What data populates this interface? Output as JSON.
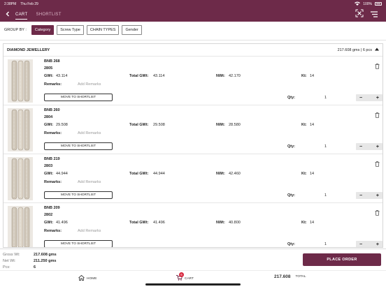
{
  "status_bar": {
    "time": "2:38PM",
    "date": "Thu Feb 29",
    "battery": "100%"
  },
  "header": {
    "tabs": [
      {
        "label": "CART"
      },
      {
        "label": "SHORTLIST"
      }
    ]
  },
  "filters": {
    "label": "GROUP BY :",
    "chips": [
      "Category",
      "Screw Type",
      "CHAIN TYPES",
      "Gender"
    ],
    "active": "Category"
  },
  "section": {
    "title": "DIAMOND JEWELLERY",
    "summary": "217.608 gms | 6 pcs"
  },
  "labels": {
    "gwt": "GWt:",
    "total_gwt": "Total GWt:",
    "nwt": "NWt:",
    "kt": "Kt:",
    "remarks": "Remarks:",
    "add_remarks": "Add Remarks",
    "qty": "Qty:",
    "move": "MOVE TO SHORTLIST",
    "minus": "−",
    "plus": "+"
  },
  "items": [
    {
      "name": "BNB 268",
      "code": "2805",
      "gwt": "43.114",
      "total_gwt": "43.114",
      "nwt": "42.170",
      "kt": "14",
      "qty": "1"
    },
    {
      "name": "BNB 260",
      "code": "2804",
      "gwt": "29.508",
      "total_gwt": "29.508",
      "nwt": "28.580",
      "kt": "14",
      "qty": "1"
    },
    {
      "name": "BNB 219",
      "code": "2803",
      "gwt": "44.944",
      "total_gwt": "44.944",
      "nwt": "42.460",
      "kt": "14",
      "qty": "1"
    },
    {
      "name": "BNB 209",
      "code": "2802",
      "gwt": "41.496",
      "total_gwt": "41.496",
      "nwt": "40.800",
      "kt": "14",
      "qty": "1"
    }
  ],
  "footer": {
    "gross_label": "Gross Wt:",
    "gross": "217.608 gms",
    "net_label": "Net Wt:",
    "net": "211.250 gms",
    "pcs_label": "Pcs:",
    "pcs": "6",
    "place_order": "PLACE ORDER"
  },
  "bottom_nav": {
    "home": "HOME",
    "cart": "CART",
    "cart_badge": "6",
    "total_value": "217.608",
    "total_label": "TOTAL"
  },
  "colors": {
    "brand": "#6d2a49"
  }
}
